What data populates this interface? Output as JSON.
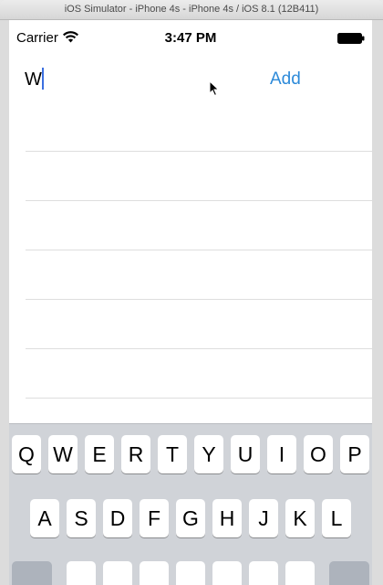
{
  "window": {
    "title": "iOS Simulator - iPhone 4s - iPhone 4s / iOS 8.1 (12B411)"
  },
  "status_bar": {
    "carrier": "Carrier",
    "time": "3:47 PM",
    "wifi_icon": "wifi-icon",
    "battery_icon": "battery-icon"
  },
  "form": {
    "input_value": "W",
    "add_label": "Add"
  },
  "list": {
    "row_count": 5
  },
  "keyboard": {
    "row1": [
      "Q",
      "W",
      "E",
      "R",
      "T",
      "Y",
      "U",
      "I",
      "O",
      "P"
    ],
    "row2": [
      "A",
      "S",
      "D",
      "F",
      "G",
      "H",
      "J",
      "K",
      "L"
    ]
  },
  "colors": {
    "accent": "#2d8ad9",
    "caret": "#3b6fe0",
    "keyboard_bg": "#d0d3d8",
    "key_bg": "#ffffff"
  }
}
